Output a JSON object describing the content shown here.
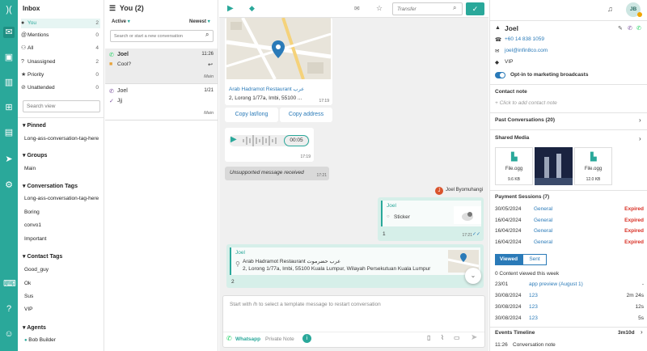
{
  "rail": {
    "icons": [
      "logo-icon",
      "inbox-icon",
      "contacts-icon",
      "reports-icon",
      "org-icon",
      "broadcast-icon",
      "campaign-icon",
      "settings-icon",
      "keyboard-icon",
      "help-icon",
      "profile-icon"
    ]
  },
  "inbox": {
    "title": "Inbox",
    "items": [
      {
        "icon": "user-icon",
        "label": "You",
        "count": "2"
      },
      {
        "icon": "at-icon",
        "label": "Mentions",
        "count": "0"
      },
      {
        "icon": "people-icon",
        "label": "All",
        "count": "4"
      },
      {
        "icon": "question-icon",
        "label": "Unassigned",
        "count": "2"
      },
      {
        "icon": "star-icon",
        "label": "Priority",
        "count": "0"
      },
      {
        "icon": "ban-icon",
        "label": "Unattended",
        "count": "0"
      }
    ],
    "search_placeholder": "Search view",
    "pinned_title": "Pinned",
    "pinned": [
      "Long-ass-conversation-tag-here"
    ],
    "groups_title": "Groups",
    "groups": [
      "Main"
    ],
    "tags_title": "Conversation Tags",
    "tags": [
      "Long-ass-conversation-tag-here",
      "Boring",
      "convo1",
      "Important"
    ],
    "contact_tags_title": "Contact Tags",
    "contact_tags": [
      "Good_guy",
      "Ok",
      "Sus",
      "VIP"
    ],
    "agents_title": "Agents",
    "agents": [
      "Bob Builder"
    ]
  },
  "list": {
    "title": "You (2)",
    "filter": "Active",
    "sort": "Newest",
    "search_placeholder": "Search or start a new conversation",
    "conversations": [
      {
        "name": "Joel",
        "time": "11:26",
        "preview": "Cool?",
        "group": "Main",
        "channel": "whatsapp"
      },
      {
        "name": "Joel",
        "time": "1/21",
        "preview": "Jjj",
        "group": "Main",
        "channel": "viber"
      }
    ]
  },
  "chat": {
    "transfer_placeholder": "Transfer",
    "location1": {
      "name": "Arab Hadramot Restaurant عرب",
      "address": "2, Lorong 1/77a, Imbi, 55100 ...",
      "time": "17:19",
      "copy1": "Copy lat/long",
      "copy2": "Copy address"
    },
    "audio": {
      "duration": "00:05",
      "time": "17:19"
    },
    "unsupported": {
      "text": "Unsupported message received",
      "time": "17:21"
    },
    "agent_name": "Joel Byomuhangi",
    "agent_initial": "J",
    "sticker_msg": {
      "reply_name": "Joel",
      "reply_text": "Sticker",
      "number": "1",
      "time": "17:21"
    },
    "location2": {
      "reply_name": "Joel",
      "name": "Arab Hadramot Restaurant عرب حضرموت",
      "address": "2, Lorong 1/77a, Imbi, 55100 Kuala Lumpur, Wilayah Persekutuan Kuala Lumpur",
      "number": "2"
    },
    "composer_placeholder": "Start with /h to select a template message to restart conversation",
    "channel": "Whatsapp",
    "private_note": "Private Note"
  },
  "contact": {
    "name": "Joel",
    "phone": "+60 14 838 1059",
    "email": "joel@infin8co.com",
    "tag": "VIP",
    "optin": "Opt-in to marketing broadcasts",
    "avatar": "JB",
    "contact_note_title": "Contact note",
    "contact_note_placeholder": "Click to add contact note",
    "past_title": "Past Conversations (20)",
    "media_title": "Shared Media",
    "media": [
      {
        "name": "File.ogg",
        "size": "9.6 KB"
      },
      {
        "name": "",
        "size": ""
      },
      {
        "name": "File.ogg",
        "size": "12.0 KB"
      }
    ],
    "payments_title": "Payment Sessions (7)",
    "payments": [
      {
        "date": "30/05/2024",
        "type": "General",
        "status": "Expired"
      },
      {
        "date": "16/04/2024",
        "type": "General",
        "status": "Expired"
      },
      {
        "date": "16/04/2024",
        "type": "General",
        "status": "Expired"
      },
      {
        "date": "16/04/2024",
        "type": "General",
        "status": "Expired"
      }
    ],
    "tab_viewed": "Viewed",
    "tab_sent": "Sent",
    "viewed_title": "0 Content viewed this week",
    "viewed": [
      {
        "date": "23/01",
        "item": "app preview (August 1)",
        "dur": "-"
      },
      {
        "date": "30/08/2024",
        "item": "123",
        "dur": "2m 24s"
      },
      {
        "date": "30/08/2024",
        "item": "123",
        "dur": "12s"
      },
      {
        "date": "30/08/2024",
        "item": "123",
        "dur": "5s"
      }
    ],
    "events_title": "Events Timeline",
    "events_dur": "3m10d",
    "event_time": "11:26",
    "event_label": "Conversation note"
  }
}
